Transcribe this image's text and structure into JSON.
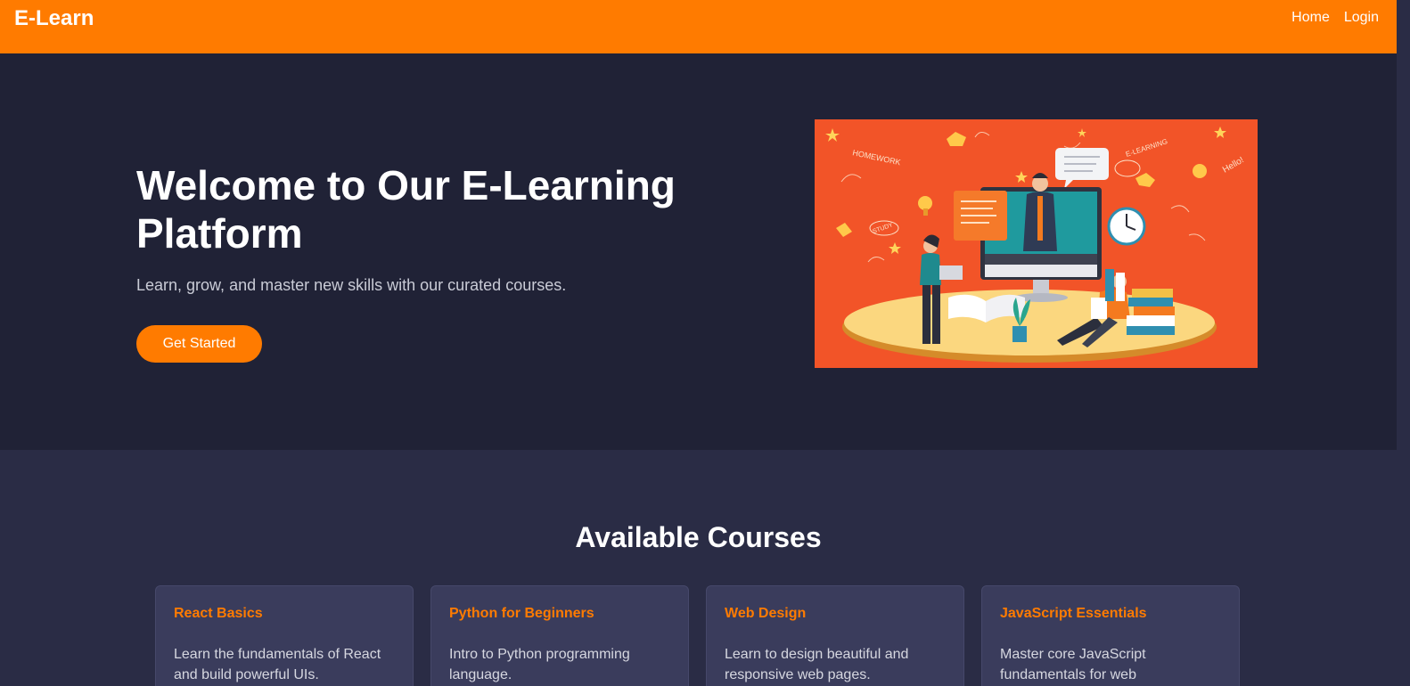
{
  "nav": {
    "brand": "E-Learn",
    "links": [
      "Home",
      "Login"
    ]
  },
  "hero": {
    "title": "Welcome to Our E-Learning Platform",
    "subtitle": "Learn, grow, and master new skills with our curated courses.",
    "cta_label": "Get Started",
    "illustration": {
      "background": "#f25428",
      "doodles": [
        "HOMEWORK",
        "E-LEARNING",
        "Hello!",
        "STUDY"
      ]
    }
  },
  "courses": {
    "title": "Available Courses",
    "items": [
      {
        "title": "React Basics",
        "description": "Learn the fundamentals of React and build powerful UIs."
      },
      {
        "title": "Python for Beginners",
        "description": "Intro to Python programming language."
      },
      {
        "title": "Web Design",
        "description": "Learn to design beautiful and responsive web pages."
      },
      {
        "title": "JavaScript Essentials",
        "description": "Master core JavaScript fundamentals for web"
      }
    ]
  },
  "colors": {
    "accent": "#ff7b00",
    "hero_bg": "#202236",
    "section_bg": "#2a2c45",
    "card_bg": "#3a3c5c"
  }
}
